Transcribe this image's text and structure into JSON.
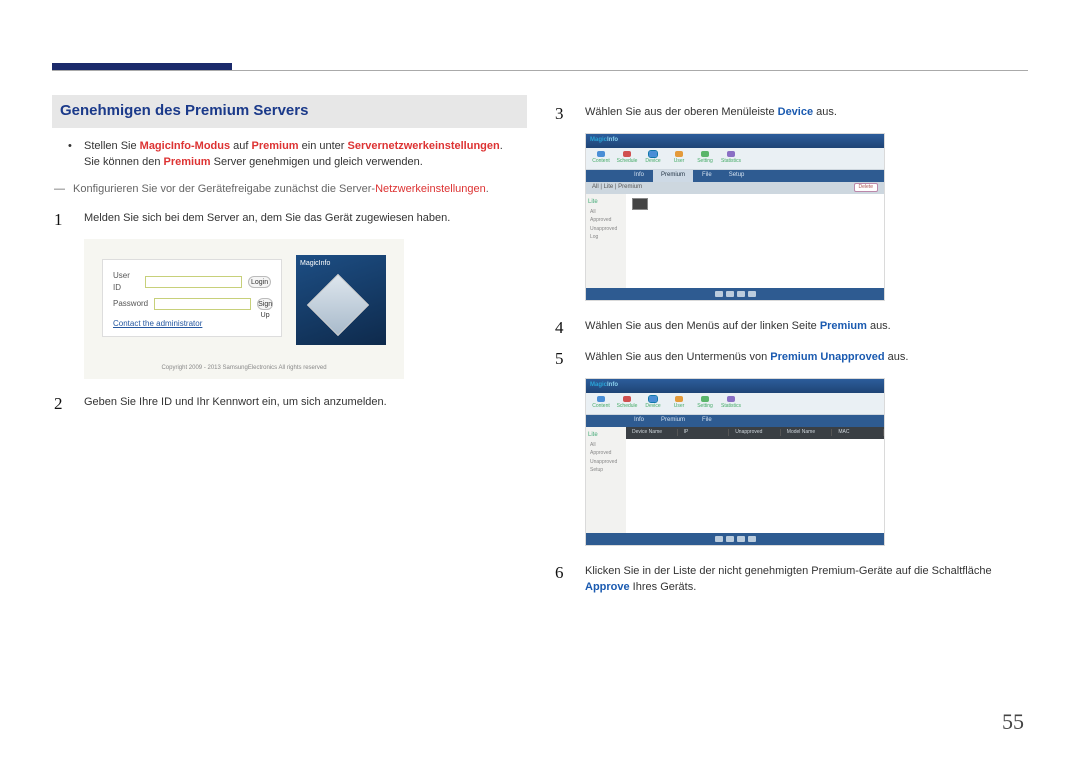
{
  "page_number": "55",
  "left": {
    "section_title": "Genehmigen des Premium Servers",
    "bullet1_pre": "Stellen Sie ",
    "bullet1_red1": "MagicInfo-Modus",
    "bullet1_mid1": " auf ",
    "bullet1_red2": "Premium",
    "bullet1_mid2": " ein unter ",
    "bullet1_red3": "Servernetzwerkeinstellungen",
    "bullet1_post": ".",
    "bullet1_line2a": "Sie können den ",
    "bullet1_line2_red": "Premium",
    "bullet1_line2b": " Server genehmigen und gleich verwenden.",
    "dash_pre": "Konfigurieren Sie vor der Gerätefreigabe zunächst die Server-",
    "dash_red": "Netzwerkeinstellungen",
    "dash_post": ".",
    "step1": "Melden Sie sich bei dem Server an, dem Sie das Gerät zugewiesen haben.",
    "step2": "Geben Sie Ihre ID und Ihr Kennwort ein, um sich anzumelden.",
    "login": {
      "user_id_label": "User ID",
      "password_label": "Password",
      "login_btn": "Login",
      "signup_btn": "Sign Up",
      "admin_link": "Contact the administrator",
      "right_title": "MagicInfo",
      "copyright": "Copyright 2009 - 2013 SamsungElectronics All rights reserved"
    }
  },
  "right": {
    "step3_pre": "Wählen Sie aus der oberen Menüleiste ",
    "step3_blue": "Device",
    "step3_post": " aus.",
    "step4_pre": "Wählen Sie aus den Menüs auf der linken Seite ",
    "step4_blue": "Premium",
    "step4_post": " aus.",
    "step5_pre": "Wählen Sie aus den Untermenüs von ",
    "step5_blue": "Premium Unapproved",
    "step5_post": " aus.",
    "step6_pre": "Klicken Sie in der Liste der nicht genehmigten Premium-Geräte auf die Schaltfläche ",
    "step6_blue": "Approve",
    "step6_post": " Ihres Geräts.",
    "app": {
      "logo_a": "Magic",
      "logo_b": "Info",
      "tb_icons": [
        "Content",
        "Schedule",
        "Device",
        "User",
        "Setting",
        "Statistics"
      ],
      "tabs_top": [
        "Info",
        "Premium",
        "File",
        "Setup"
      ],
      "subtabs": [
        "All",
        "Lite",
        "Premium"
      ],
      "pill": "Delete",
      "sidebar_header": "Lite",
      "sidebar_items": [
        "All",
        "Approved",
        "Unapproved",
        "Log",
        "Setup"
      ],
      "cols": [
        "Device Name",
        "IP",
        "Unapproved",
        "Model Name",
        "MAC"
      ]
    }
  }
}
